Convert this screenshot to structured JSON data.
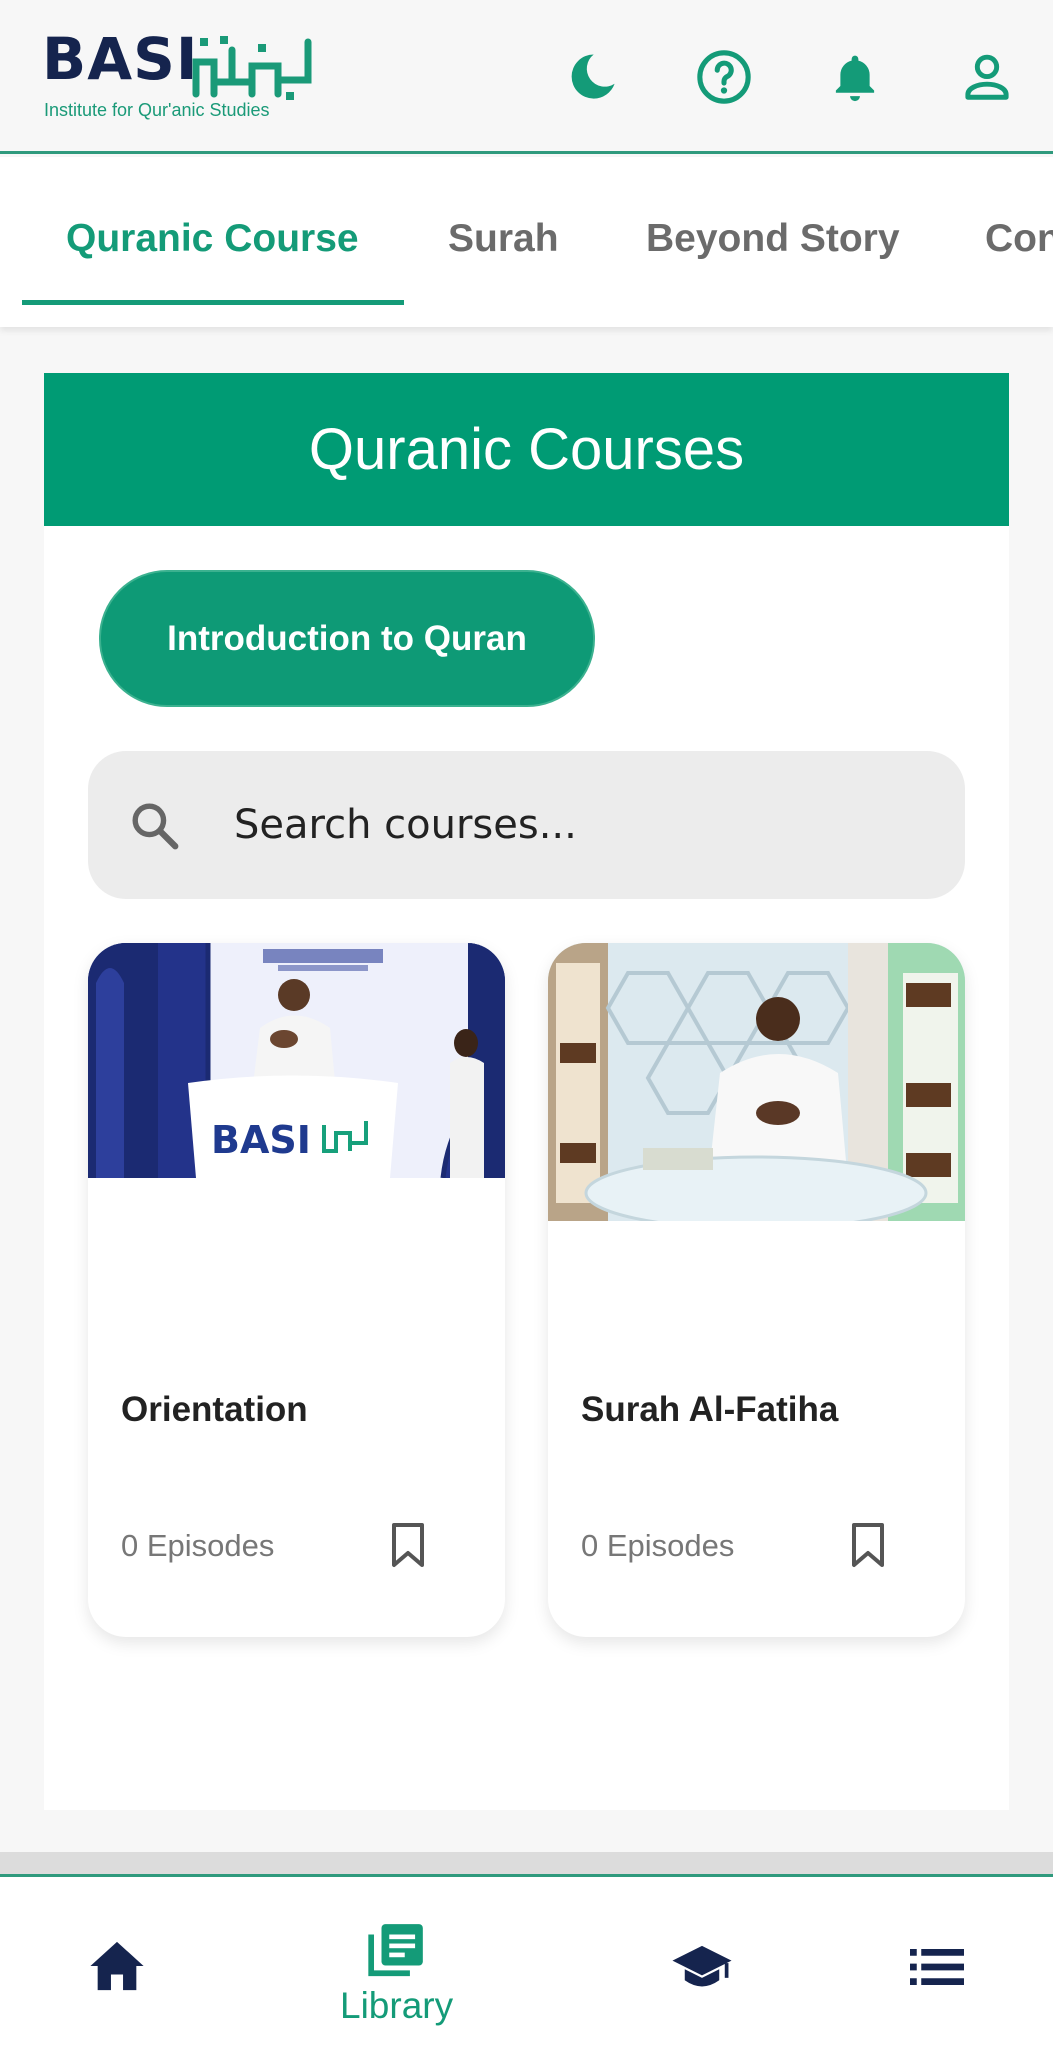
{
  "header": {
    "logo_main": "BASI",
    "logo_subtitle": "Institute for Qur'anic Studies",
    "icons": [
      "moon-icon",
      "help-icon",
      "bell-icon",
      "user-icon"
    ]
  },
  "tabs": [
    {
      "label": "Quranic Course",
      "active": true
    },
    {
      "label": "Surah",
      "active": false
    },
    {
      "label": "Beyond Story",
      "active": false
    },
    {
      "label": "Con",
      "active": false
    }
  ],
  "main": {
    "banner_title": "Quranic Courses",
    "filter_chip": "Introduction to Quran",
    "search_placeholder": "Search courses...",
    "courses": [
      {
        "title": "Orientation",
        "episodes": "0 Episodes",
        "logo_text": "BASI"
      },
      {
        "title": "Surah Al-Fatiha",
        "episodes": "0 Episodes"
      }
    ]
  },
  "bottom_nav": {
    "items": [
      {
        "icon": "home-icon",
        "label": ""
      },
      {
        "icon": "library-icon",
        "label": "Library",
        "active": true
      },
      {
        "icon": "graduation-cap-icon",
        "label": ""
      },
      {
        "icon": "list-icon",
        "label": ""
      }
    ]
  },
  "colors": {
    "accent": "#149b78",
    "banner": "#009b74",
    "navy": "#15244e"
  }
}
